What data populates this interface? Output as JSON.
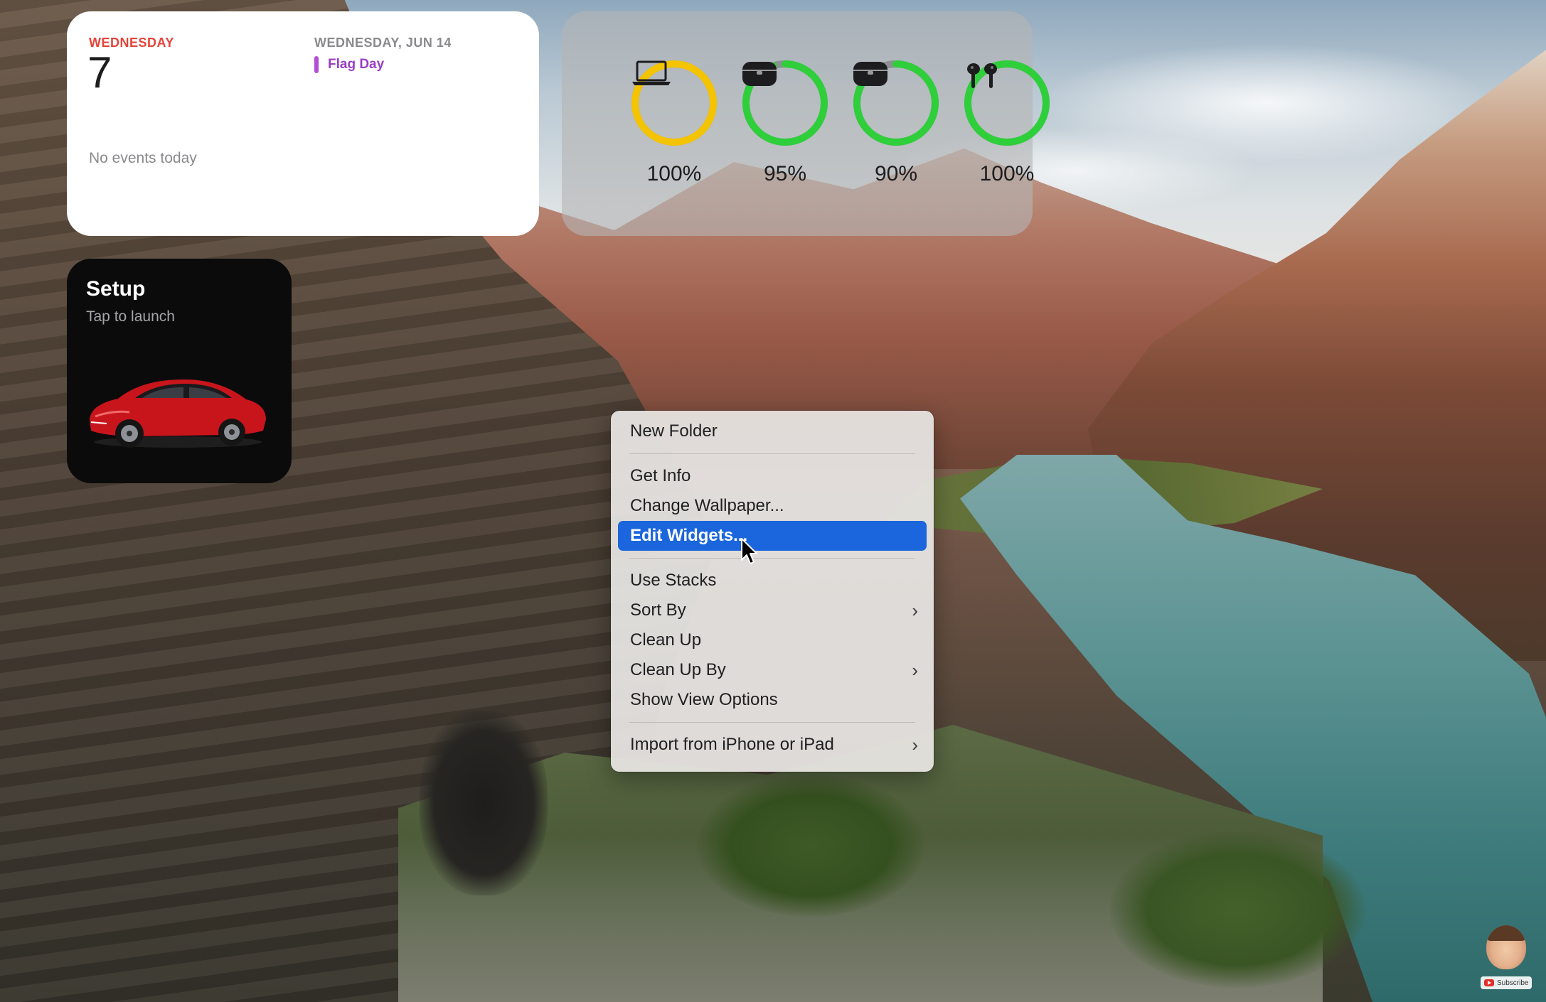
{
  "calendar_widget": {
    "day_name": "WEDNESDAY",
    "date_number": "7",
    "no_events": "No events today",
    "upcoming_date": "WEDNESDAY, JUN 14",
    "event_title": "Flag Day",
    "event_color": "#b14fd8",
    "accent_color": "#e5443a"
  },
  "battery_widget": {
    "devices": [
      {
        "icon": "laptop-icon",
        "percent": "100%",
        "level": 1.0,
        "ring_color": "#f5c400"
      },
      {
        "icon": "earbuds-case-icon",
        "percent": "95%",
        "level": 0.95,
        "ring_color": "#2ecf3a"
      },
      {
        "icon": "earbuds-case-icon",
        "percent": "90%",
        "level": 0.9,
        "ring_color": "#2ecf3a"
      },
      {
        "icon": "airpods-icon",
        "percent": "100%",
        "level": 1.0,
        "ring_color": "#2ecf3a"
      }
    ]
  },
  "setup_widget": {
    "title": "Setup",
    "subtitle": "Tap to launch",
    "image": "red-car-icon"
  },
  "context_menu": {
    "items": [
      {
        "label": "New Folder"
      },
      {
        "label": "Get Info"
      },
      {
        "label": "Change Wallpaper..."
      },
      {
        "label": "Edit Widgets...",
        "selected": true
      },
      {
        "label": "Use Stacks"
      },
      {
        "label": "Sort By",
        "submenu": true
      },
      {
        "label": "Clean Up"
      },
      {
        "label": "Clean Up By",
        "submenu": true
      },
      {
        "label": "Show View Options"
      },
      {
        "label": "Import from iPhone or iPad",
        "submenu": true
      }
    ],
    "selected_color": "#1b66dc",
    "chevron": "›"
  },
  "subscribe_overlay": {
    "label": "Subscribe"
  }
}
